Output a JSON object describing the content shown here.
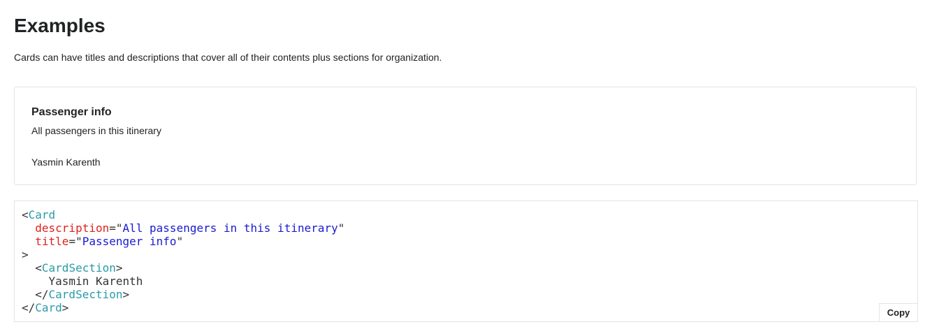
{
  "page": {
    "title": "Examples",
    "description": "Cards can have titles and descriptions that cover all of their contents plus sections for organization."
  },
  "preview_card": {
    "title": "Passenger info",
    "description": "All passengers in this itinerary",
    "section_text": "Yasmin Karenth"
  },
  "code": {
    "lt": "<",
    "gt": ">",
    "lt_slash": "</",
    "card_tag": "Card",
    "section_tag": "CardSection",
    "attr_description": "description",
    "attr_title": "title",
    "eq_quote": "=\"",
    "quote": "\"",
    "description_value": "All passengers in this itinerary",
    "title_value": "Passenger info",
    "section_content": "Yasmin Karenth",
    "indent1": "  ",
    "indent2": "    "
  },
  "copy_button_label": "Copy",
  "colors": {
    "tag": "#2a9aa8",
    "attribute": "#e0201c",
    "string": "#1a1ad0",
    "text": "#333333",
    "border": "#e1e3e5"
  }
}
